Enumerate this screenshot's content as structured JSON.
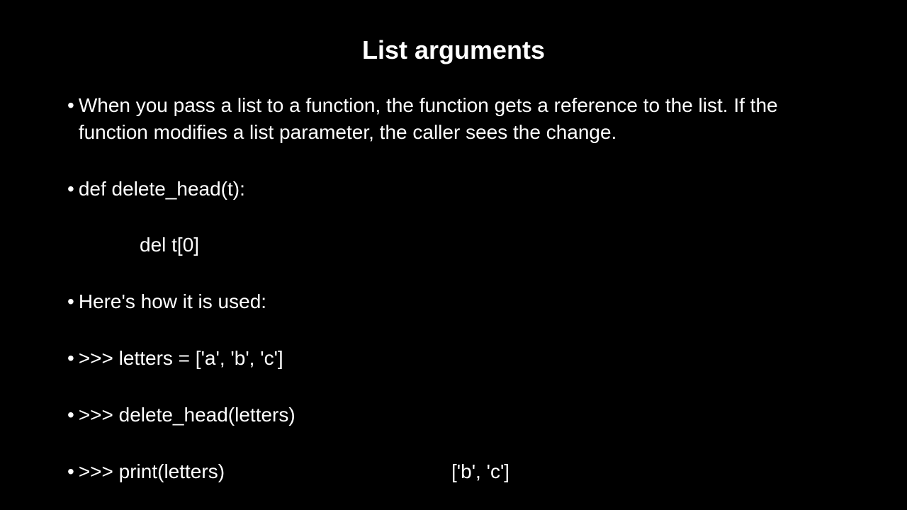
{
  "title": "List arguments",
  "bullets": {
    "b1": "When you pass a list to a function, the function gets a reference to the list. If the function modifies a list parameter, the caller sees the change.",
    "b2": "def delete_head(t):",
    "indent": "del t[0]",
    "b3": "Here's how it is used:",
    "b4": ">>> letters = ['a', 'b', 'c']",
    "b5": ">>> delete_head(letters)",
    "b6": ">>> print(letters)",
    "output": "['b', 'c']"
  },
  "bullet_char": "•"
}
